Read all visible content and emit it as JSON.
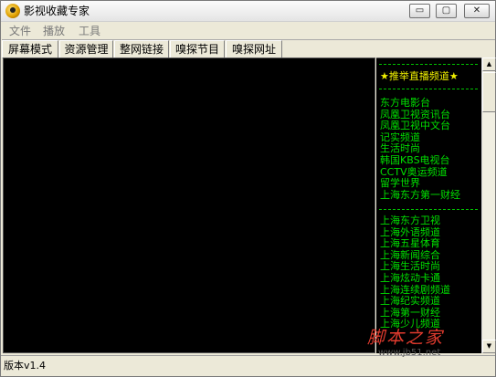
{
  "window": {
    "title": "影视收藏专家",
    "controls": {
      "minimize": "▭",
      "maximize": "▢",
      "close": "✕"
    }
  },
  "menu": [
    "文件",
    "播放",
    "工具"
  ],
  "toolbar": [
    "屏幕模式",
    "资源管理",
    "整网链接",
    "嗅探节目",
    "嗅探网址"
  ],
  "channels": {
    "header": "★推举直播频道★",
    "separator": "---------------",
    "group1": [
      "东方电影台",
      "凤凰卫视资讯台",
      "凤凰卫视中文台",
      "记实频道",
      "生活时尚",
      "韩国KBS电视台",
      "CCTV奥运频道",
      "留学世界",
      "上海东方第一财经"
    ],
    "group2": [
      "上海东方卫视",
      "上海外语频道",
      "上海五星体育",
      "上海新闻综合",
      "上海生活时尚",
      "上海炫动卡通",
      "上海连续剧频道",
      "上海纪实频道",
      "上海第一财经",
      "上海少儿频道"
    ]
  },
  "scrollbar": {
    "up": "▲",
    "down": "▼"
  },
  "status": {
    "version": "版本v1.4"
  },
  "watermark": {
    "main": "脚本之家",
    "url": "www.jb51.net"
  },
  "colors": {
    "channel_text": "#00e000",
    "header_text": "#f0f000",
    "video_bg": "#000000",
    "watermark": "#e23b2e"
  }
}
